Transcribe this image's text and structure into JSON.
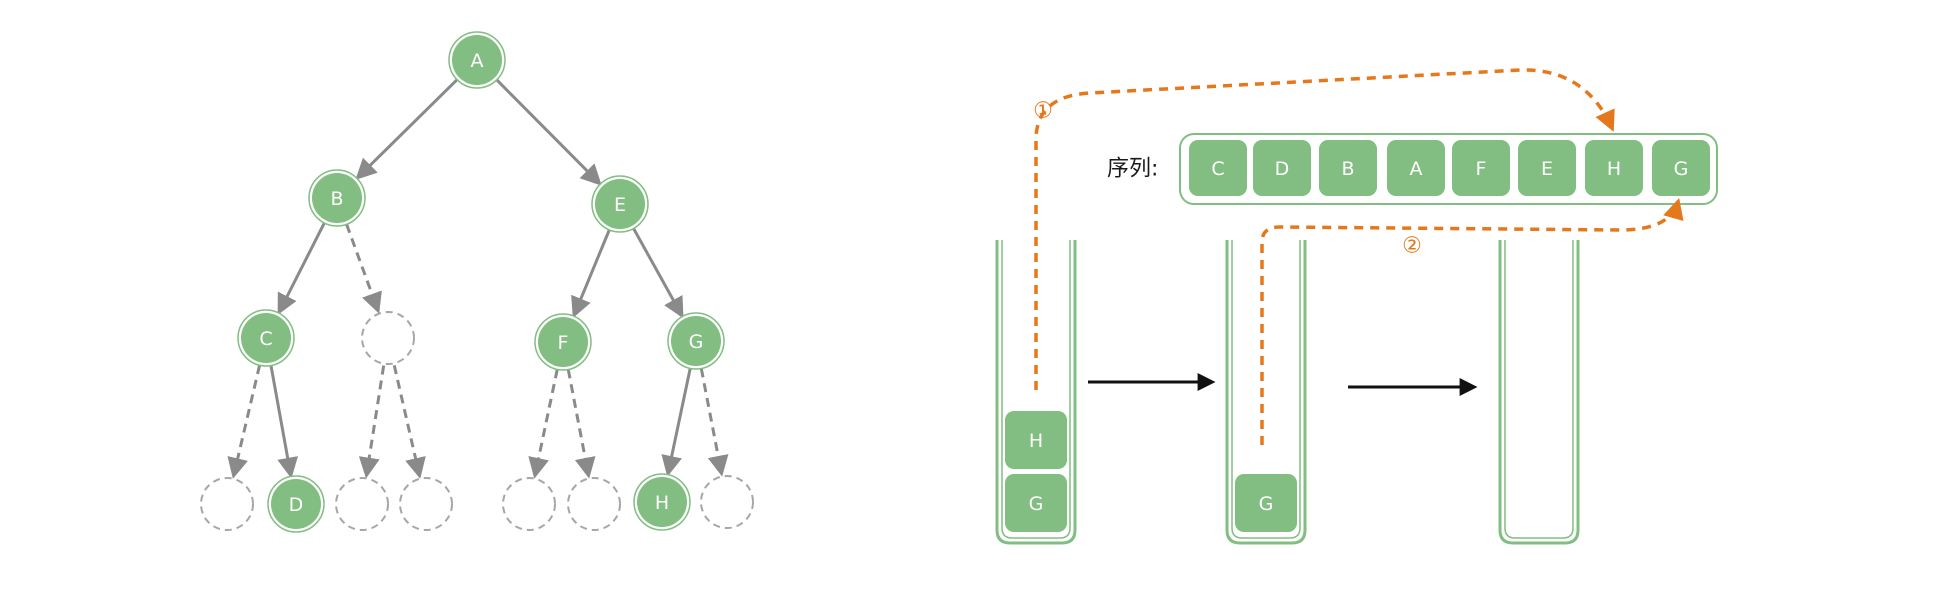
{
  "colors": {
    "node_fill": "#82bd82",
    "node_ring": "#82bd82",
    "stack_stroke": "#82bd82",
    "edge": "#8a8a8a",
    "empty_node": "#a6a6a6",
    "orange": "#e5781a",
    "arrow": "#111111"
  },
  "tree": {
    "nodes": [
      {
        "id": "A",
        "label": "A",
        "empty": false
      },
      {
        "id": "B",
        "label": "B",
        "empty": false
      },
      {
        "id": "E",
        "label": "E",
        "empty": false
      },
      {
        "id": "C",
        "label": "C",
        "empty": false
      },
      {
        "id": "BR",
        "label": "",
        "empty": true
      },
      {
        "id": "F",
        "label": "F",
        "empty": false
      },
      {
        "id": "G",
        "label": "G",
        "empty": false
      },
      {
        "id": "CL",
        "label": "",
        "empty": true
      },
      {
        "id": "D",
        "label": "D",
        "empty": false
      },
      {
        "id": "BRL",
        "label": "",
        "empty": true
      },
      {
        "id": "BRR",
        "label": "",
        "empty": true
      },
      {
        "id": "FL",
        "label": "",
        "empty": true
      },
      {
        "id": "FR",
        "label": "",
        "empty": true
      },
      {
        "id": "H",
        "label": "H",
        "empty": false
      },
      {
        "id": "GR",
        "label": "",
        "empty": true
      }
    ],
    "edges": [
      {
        "from": "A",
        "to": "B",
        "dashed": false
      },
      {
        "from": "A",
        "to": "E",
        "dashed": false
      },
      {
        "from": "B",
        "to": "C",
        "dashed": false
      },
      {
        "from": "B",
        "to": "BR",
        "dashed": true
      },
      {
        "from": "E",
        "to": "F",
        "dashed": false
      },
      {
        "from": "E",
        "to": "G",
        "dashed": false
      },
      {
        "from": "C",
        "to": "CL",
        "dashed": true
      },
      {
        "from": "C",
        "to": "D",
        "dashed": false
      },
      {
        "from": "BR",
        "to": "BRL",
        "dashed": true
      },
      {
        "from": "BR",
        "to": "BRR",
        "dashed": true
      },
      {
        "from": "F",
        "to": "FL",
        "dashed": true
      },
      {
        "from": "F",
        "to": "FR",
        "dashed": true
      },
      {
        "from": "G",
        "to": "H",
        "dashed": false
      },
      {
        "from": "G",
        "to": "GR",
        "dashed": true
      }
    ]
  },
  "sequence": {
    "label": "序列:",
    "items": [
      "C",
      "D",
      "B",
      "A",
      "F",
      "E",
      "H",
      "G"
    ]
  },
  "stacks": [
    {
      "items": [
        "G",
        "H"
      ]
    },
    {
      "items": [
        "G"
      ]
    },
    {
      "items": []
    }
  ],
  "steps": {
    "step1": "①",
    "step2": "②"
  }
}
